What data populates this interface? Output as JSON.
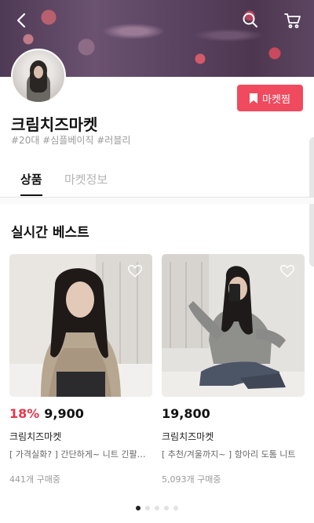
{
  "header": {
    "back_icon": "back-arrow-icon",
    "search_icon": "search-icon",
    "cart_icon": "cart-icon"
  },
  "shop": {
    "name": "크림치즈마켓",
    "tags": "#20대 #심플베이직 #러블리",
    "favorite_label": "마켓찜",
    "favorite_icon": "bookmark-icon",
    "accent_color": "#ef4a5e"
  },
  "tabs": [
    {
      "label": "상품",
      "active": true
    },
    {
      "label": "마켓정보",
      "active": false
    }
  ],
  "section": {
    "title": "실시간 베스트"
  },
  "products": [
    {
      "discount": "18%",
      "price": "9,900",
      "brand": "크림치즈마켓",
      "description": "[ 가격실화? ] 간단하게~ 니트 긴팔티...",
      "buyers": "441개 구매중",
      "wishlist_icon": "heart-outline-icon"
    },
    {
      "discount": "",
      "price": "19,800",
      "brand": "크림치즈마켓",
      "description": "[ 추천/겨울까지~ ] 항아리 도톰 니트",
      "buyers": "5,093개 구매중",
      "wishlist_icon": "heart-outline-icon"
    }
  ],
  "pagination": {
    "total": 5,
    "current": 1
  }
}
